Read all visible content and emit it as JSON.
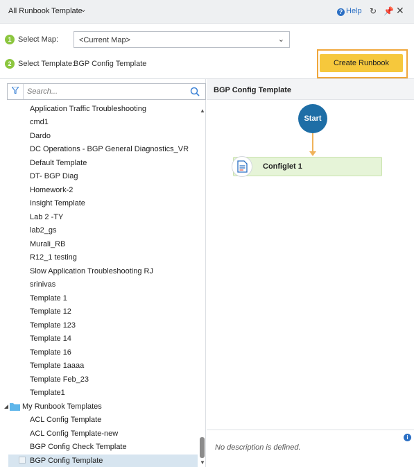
{
  "window": {
    "title": "All Runbook Template",
    "help_label": "Help"
  },
  "steps": {
    "step1_number": "1",
    "step1_label": "Select Map:",
    "map_value": "<Current Map>",
    "step2_number": "2",
    "step2_label": "Select Template:",
    "template_value": "BGP Config Template",
    "create_button": "Create Runbook"
  },
  "search": {
    "placeholder": "Search..."
  },
  "template_list": {
    "items": [
      "Application Traffic Troubleshooting",
      "cmd1",
      "Dardo",
      "DC Operations - BGP General Diagnostics_VR",
      "Default Template",
      "DT- BGP Diag",
      "Homework-2",
      "Insight Template",
      "Lab 2 -TY",
      "lab2_gs",
      "Murali_RB",
      "R12_1 testing",
      "Slow Application Troubleshooting RJ",
      "srinivas",
      "Template 1",
      "Template 12",
      "Template 123",
      "Template 14",
      "Template 16",
      "Template 1aaaa",
      "Template Feb_23",
      "Template1"
    ],
    "folder_label": "My Runbook Templates",
    "folder_items": [
      "ACL Config Template",
      "ACL Config Template-new",
      "BGP Config Check Template",
      "BGP Config Template"
    ]
  },
  "preview": {
    "title": "BGP Config Template",
    "start_label": "Start",
    "configlet_label": "Configlet 1",
    "description": "No description is defined."
  },
  "colors": {
    "accent_orange": "#f6c83c",
    "highlight_outline": "#f0a63a",
    "start_node": "#1e6ea6",
    "configlet_bg": "#e6f4d8",
    "step_badge": "#8cc63f",
    "selected_row": "#d7e5f0"
  }
}
